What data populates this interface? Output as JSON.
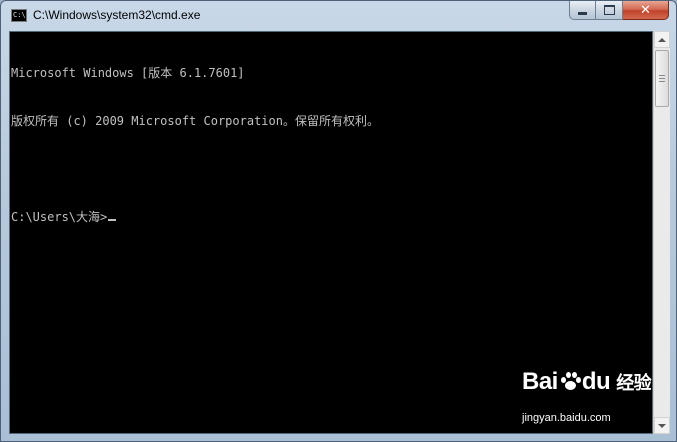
{
  "window": {
    "title": "C:\\Windows\\system32\\cmd.exe",
    "icon": "cmd-icon",
    "icon_text": "C:\\"
  },
  "controls": {
    "minimize": "minimize-icon",
    "maximize": "maximize-icon",
    "close": "close-icon",
    "close_glyph": "✕"
  },
  "console": {
    "lines": [
      "Microsoft Windows [版本 6.1.7601]",
      "版权所有 (c) 2009 Microsoft Corporation。保留所有权利。",
      "",
      "C:\\Users\\大海>"
    ],
    "text_color": "#c0c0c0",
    "background": "#000000"
  },
  "watermark": {
    "brand": "Bai",
    "brand_suffix": "du",
    "brand_cn": "经验",
    "url": "jingyan.baidu.com"
  }
}
